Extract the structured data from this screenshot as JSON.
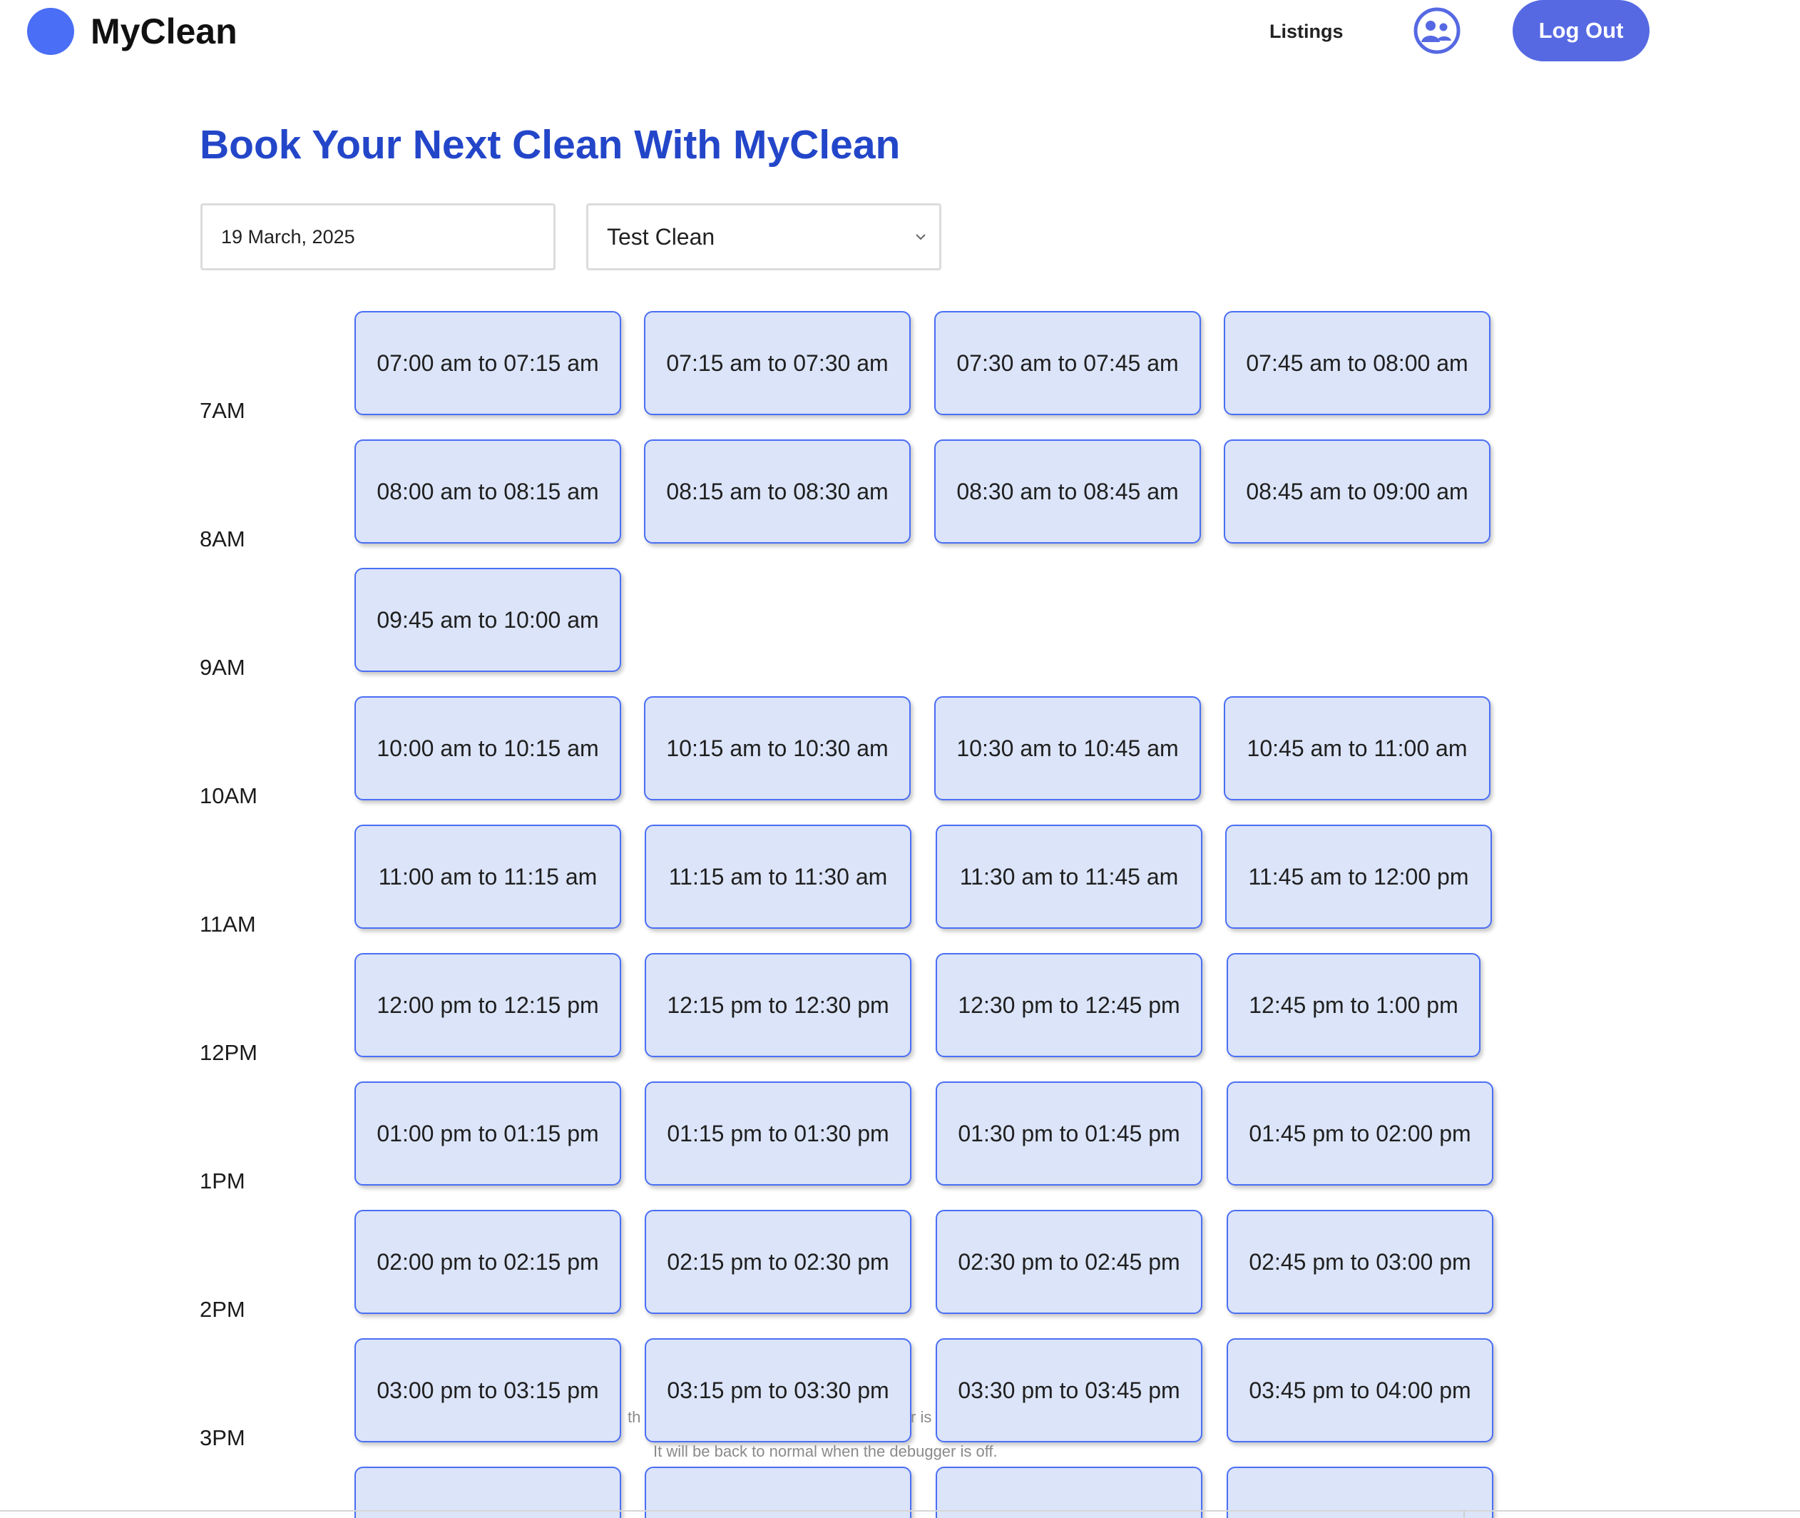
{
  "header": {
    "brand": "MyClean",
    "nav_listings": "Listings",
    "logout_label": "Log Out",
    "accent_color": "#4a6ef5"
  },
  "main": {
    "title": "Book Your Next Clean With MyClean",
    "date_value": "19 March, 2025",
    "service_selected": "Test Clean"
  },
  "schedule": {
    "hours": [
      "7AM",
      "8AM",
      "9AM",
      "10AM",
      "11AM",
      "12PM",
      "1PM",
      "2PM",
      "3PM"
    ],
    "rows": [
      [
        "07:00 am to 07:15 am",
        "07:15 am to 07:30 am",
        "07:30 am to 07:45 am",
        "07:45 am to 08:00 am"
      ],
      [
        "08:00 am to 08:15 am",
        "08:15 am to 08:30 am",
        "08:30 am to 08:45 am",
        "08:45 am to 09:00 am"
      ],
      [
        "09:45 am to 10:00 am"
      ],
      [
        "10:00 am to 10:15 am",
        "10:15 am to 10:30 am",
        "10:30 am to 10:45 am",
        "10:45 am to 11:00 am"
      ],
      [
        "11:00 am to 11:15 am",
        "11:15 am to 11:30 am",
        "11:30 am to 11:45 am",
        "11:45 am to 12:00 pm"
      ],
      [
        "12:00 pm to 12:15 pm",
        "12:15 pm to 12:30 pm",
        "12:30 pm to 12:45 pm",
        "12:45 pm to 1:00 pm"
      ],
      [
        "01:00 pm to 01:15 pm",
        "01:15 pm to 01:30 pm",
        "01:30 pm to 01:45 pm",
        "01:45 pm to 02:00 pm"
      ],
      [
        "02:00 pm to 02:15 pm",
        "02:15 pm to 02:30 pm",
        "02:30 pm to 02:45 pm",
        "02:45 pm to 03:00 pm"
      ],
      [
        "03:00 pm to 03:15 pm",
        "03:15 pm to 03:30 pm",
        "03:30 pm to 03:45 pm",
        "03:45 pm to 04:00 pm"
      ],
      [
        "",
        "",
        "",
        ""
      ]
    ]
  },
  "debug_overlay": {
    "fragment_1": "th",
    "fragment_2": "r is",
    "line_2": "It will be back to normal when the debugger is off."
  }
}
